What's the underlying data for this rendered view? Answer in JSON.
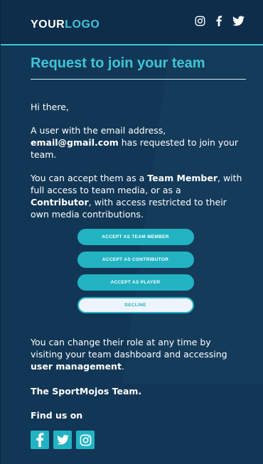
{
  "header": {
    "logo_part1": "YOUR",
    "logo_part2": "LOGO",
    "social_icons": [
      "instagram-icon",
      "facebook-icon",
      "twitter-icon"
    ]
  },
  "main": {
    "title": "Request to join your team",
    "greeting": "Hi there,",
    "p1_prefix": "A user with the email address, ",
    "p1_email": "email@gmail.com",
    "p1_suffix": " has requested to join your team.",
    "p2_a": "You can accept them as a ",
    "p2_role1": "Team Member",
    "p2_b": ", with full access to team media, or as a ",
    "p2_role2": "Contributor",
    "p2_c": ", with access restricted to their own media contributions.",
    "buttons": [
      {
        "label": "ACCEPT AS TEAM MEMBER"
      },
      {
        "label": "ACCEPT AS CONTRIBUTOR"
      },
      {
        "label": "ACCEPT AS PLAYER"
      },
      {
        "label": "DECLINE"
      }
    ],
    "p3_a": "You can change their role at any time by visiting your team dashboard and accessing ",
    "p3_b": "user management",
    "p3_c": ".",
    "signoff": "The SportMojos Team.",
    "find_us": "Find us on",
    "bottom_social_icons": [
      "facebook-icon",
      "twitter-icon",
      "instagram-icon"
    ]
  },
  "colors": {
    "accent": "#3cc6d6",
    "button": "#22b3c3",
    "background": "#123756",
    "header_bg": "#0e2d4b"
  }
}
